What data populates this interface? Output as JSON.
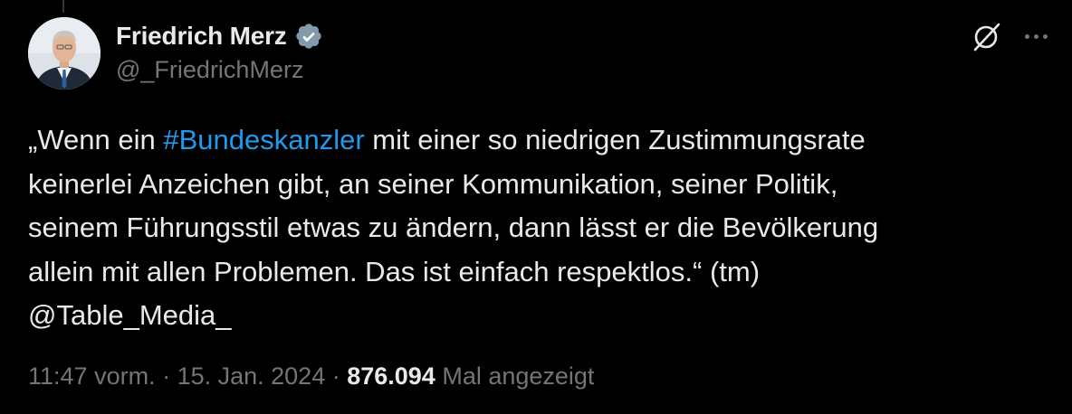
{
  "author": {
    "display_name": "Friedrich Merz",
    "handle": "@_FriedrichMerz",
    "verified_color": "#829aab"
  },
  "tweet": {
    "line1_pre": "„Wenn ein ",
    "hashtag": "#Bundeskanzler",
    "line1_post": " mit einer so niedrigen Zustimmungsrate",
    "line2": "keinerlei Anzeichen gibt, an seiner Kommunikation, seiner Politik,",
    "line3": "seinem Führungsstil etwas zu ändern, dann lässt er die Bevölkerung",
    "line4": "allein mit allen Problemen. Das ist einfach respektlos.“ (tm)",
    "line5": "@Table_Media_"
  },
  "meta": {
    "time": "11:47 vorm.",
    "sep1": " · ",
    "date": "15. Jan. 2024",
    "sep2": " · ",
    "views": "876.094",
    "views_label": " Mal angezeigt"
  },
  "icons": {
    "grok": "grok-icon",
    "more": "more-icon",
    "verified": "verified-badge-icon"
  },
  "colors": {
    "background": "#000000",
    "text": "#e7e9ea",
    "secondary": "#71767b",
    "link": "#1d9bf0"
  }
}
